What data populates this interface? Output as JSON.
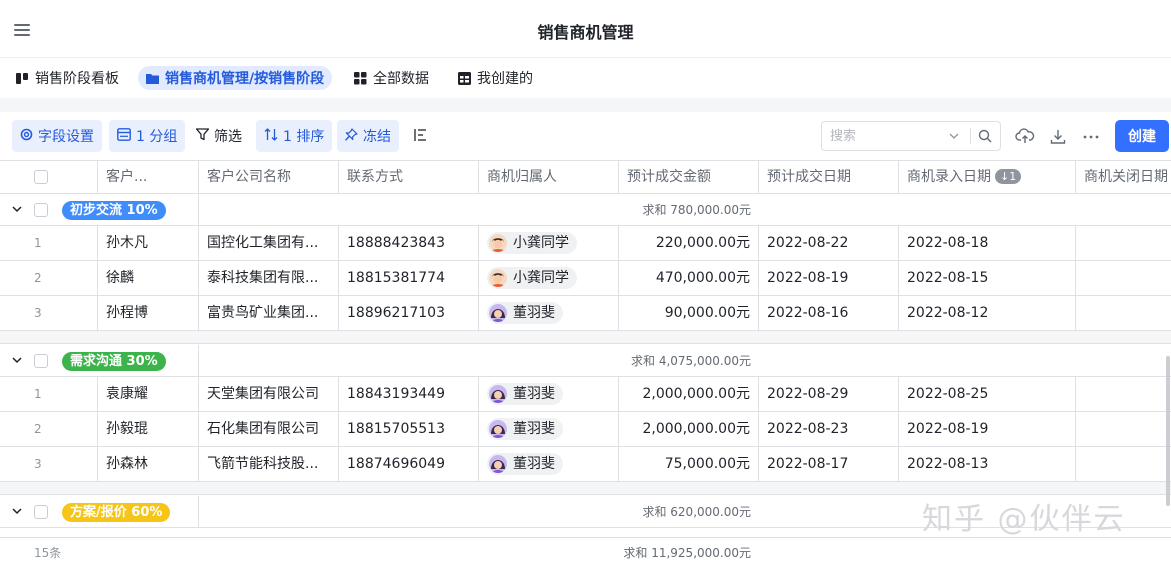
{
  "app": {
    "title": "销售商机管理"
  },
  "tabs": [
    {
      "label": "销售阶段看板",
      "icon": "kanban-icon",
      "active": false
    },
    {
      "label": "销售商机管理/按销售阶段",
      "icon": "folder-icon",
      "active": true
    },
    {
      "label": "全部数据",
      "icon": "grid-icon",
      "active": false
    },
    {
      "label": "我创建的",
      "icon": "grid-icon",
      "active": false
    }
  ],
  "toolbar": {
    "fields": "字段设置",
    "group": "1 分组",
    "filter": "筛选",
    "sort": "1 排序",
    "freeze": "冻结",
    "search_placeholder": "搜索",
    "create": "创建"
  },
  "columns": {
    "customer": "客户...",
    "company": "客户公司名称",
    "contact": "联系方式",
    "owner": "商机归属人",
    "amount": "预计成交金额",
    "deal_date": "预计成交日期",
    "entry_date": "商机录入日期",
    "entry_sort_badge": "↓1",
    "close_date": "商机关闭日期"
  },
  "groups": [
    {
      "label": "初步交流 10%",
      "color": "#3f8cfb",
      "sum": "求和 780,000.00元",
      "rows": [
        {
          "idx": "1",
          "customer": "孙木凡",
          "company": "国控化工集团有...",
          "contact": "18888423843",
          "owner": "小龚同学",
          "avatar": "boy",
          "amount": "220,000.00元",
          "deal_date": "2022-08-22",
          "entry_date": "2022-08-18"
        },
        {
          "idx": "2",
          "customer": "徐麟",
          "company": "泰科技集团有限...",
          "contact": "18815381774",
          "owner": "小龚同学",
          "avatar": "boy",
          "amount": "470,000.00元",
          "deal_date": "2022-08-19",
          "entry_date": "2022-08-15"
        },
        {
          "idx": "3",
          "customer": "孙程博",
          "company": "富贵鸟矿业集团...",
          "contact": "18896217103",
          "owner": "董羽斐",
          "avatar": "girl",
          "amount": "90,000.00元",
          "deal_date": "2022-08-16",
          "entry_date": "2022-08-12"
        }
      ]
    },
    {
      "label": "需求沟通 30%",
      "color": "#3cb44b",
      "sum": "求和 4,075,000.00元",
      "rows": [
        {
          "idx": "1",
          "customer": "袁康耀",
          "company": "天堂集团有限公司",
          "contact": "18843193449",
          "owner": "董羽斐",
          "avatar": "girl",
          "amount": "2,000,000.00元",
          "deal_date": "2022-08-29",
          "entry_date": "2022-08-25"
        },
        {
          "idx": "2",
          "customer": "孙毅琨",
          "company": "石化集团有限公司",
          "contact": "18815705513",
          "owner": "董羽斐",
          "avatar": "girl",
          "amount": "2,000,000.00元",
          "deal_date": "2022-08-23",
          "entry_date": "2022-08-19"
        },
        {
          "idx": "3",
          "customer": "孙森林",
          "company": "飞箭节能科技股...",
          "contact": "18874696049",
          "owner": "董羽斐",
          "avatar": "girl",
          "amount": "75,000.00元",
          "deal_date": "2022-08-17",
          "entry_date": "2022-08-13"
        }
      ]
    },
    {
      "label": "方案/报价 60%",
      "color": "#f5c518",
      "sum": "求和 620,000.00元",
      "rows": []
    }
  ],
  "footer": {
    "count": "15条",
    "total": "求和 11,925,000.00元"
  },
  "watermark": "知乎 @伙伴云",
  "colors": {
    "accent": "#3370ff",
    "tab_active_bg": "#e1eaff"
  }
}
